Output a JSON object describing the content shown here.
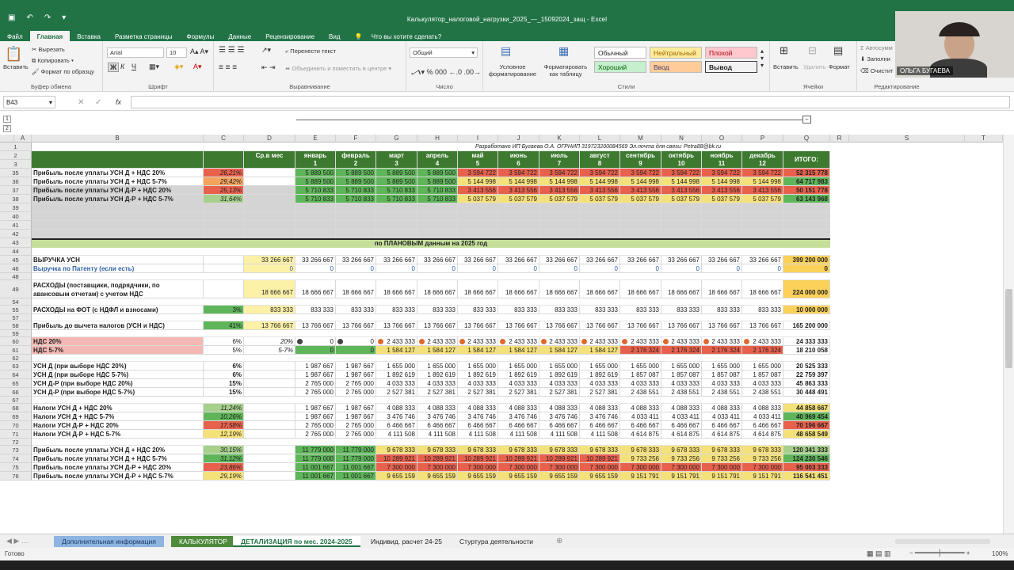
{
  "app": {
    "title": "Калькулятор_налоговой_нагрузки_2025_—_15092024_защ - Excel"
  },
  "ribbon_tabs": [
    "Файл",
    "Главная",
    "Вставка",
    "Разметка страницы",
    "Формулы",
    "Данные",
    "Рецензирование",
    "Вид"
  ],
  "tell_me": "Что вы хотите сделать?",
  "clipboard": {
    "paste": "Вставить",
    "cut": "Вырезать",
    "copy": "Копировать",
    "format_painter": "Формат по образцу",
    "label": "Буфер обмена"
  },
  "font": {
    "name": "Arial",
    "size": "10",
    "label": "Шрифт",
    "bold": "Ж",
    "italic": "К",
    "underline": "Ч"
  },
  "alignment": {
    "wrap": "Перенести текст",
    "merge": "Объединить и поместить в центре",
    "label": "Выравнивание"
  },
  "number": {
    "format": "Общий",
    "label": "Число"
  },
  "styles": {
    "conditional": "Условное форматирование",
    "as_table": "Форматировать как таблицу",
    "normal": "Обычный",
    "neutral": "Нейтральный",
    "bad": "Плохой",
    "good": "Хороший",
    "input": "Ввод",
    "output": "Вывод",
    "label": "Стили"
  },
  "cells": {
    "insert": "Вставить",
    "delete": "Удалить",
    "format": "Формат",
    "label": "Ячейки"
  },
  "editing": {
    "autosum": "Автосумм",
    "fill": "Заполни",
    "clear": "Очистит",
    "label": "Редактирование"
  },
  "webcam_name": "ОЛЬГА БУГАЕВА",
  "formula_bar": {
    "name_box": "B43",
    "fx": "fx",
    "value": ""
  },
  "columns": [
    "A",
    "B",
    "C",
    "D",
    "E",
    "F",
    "G",
    "H",
    "I",
    "J",
    "K",
    "L",
    "M",
    "N",
    "O",
    "P",
    "Q",
    "R",
    "S",
    "T"
  ],
  "header_note": "Разработано ИП Бугаева О.А. ОГРНИП 319723200084569   Эл.почта для связи: Petra88@bk.ru",
  "months": [
    {
      "name": "январь",
      "n": "1"
    },
    {
      "name": "февраль",
      "n": "2"
    },
    {
      "name": "март",
      "n": "3"
    },
    {
      "name": "апрель",
      "n": "4"
    },
    {
      "name": "май",
      "n": "5"
    },
    {
      "name": "июнь",
      "n": "6"
    },
    {
      "name": "июль",
      "n": "7"
    },
    {
      "name": "август",
      "n": "8"
    },
    {
      "name": "сентябрь",
      "n": "9"
    },
    {
      "name": "октябрь",
      "n": "10"
    },
    {
      "name": "ноябрь",
      "n": "11"
    },
    {
      "name": "декабрь",
      "n": "12"
    }
  ],
  "avg_header": "Ср.в мес",
  "total_header": "ИТОГО:",
  "top_rows": [
    {
      "row": "35",
      "label": "Прибыль после уплаты УСН Д + НДС 20%",
      "pct": "26,21%",
      "vals": [
        "5 889 500",
        "5 889 500",
        "5 889 500",
        "5 889 500",
        "3 594 722",
        "3 594 722",
        "3 594 722",
        "3 594 722",
        "3 594 722",
        "3 594 722",
        "3 594 722",
        "3 594 722"
      ],
      "total": "52 315 778"
    },
    {
      "row": "36",
      "label": "Прибыль после уплаты УСН Д + НДС 5-7%",
      "pct": "29,42%",
      "vals": [
        "5 889 500",
        "5 889 500",
        "5 889 500",
        "5 889 500",
        "5 144 998",
        "5 144 998",
        "5 144 998",
        "5 144 998",
        "5 144 998",
        "5 144 998",
        "5 144 998",
        "5 144 998"
      ],
      "total": "64 717 983"
    },
    {
      "row": "37",
      "label": "Прибыль после уплаты УСН Д-Р + НДС 20%",
      "pct": "25,13%",
      "vals": [
        "5 710 833",
        "5 710 833",
        "5 710 833",
        "5 710 833",
        "3 413 556",
        "3 413 556",
        "3 413 556",
        "3 413 556",
        "3 413 556",
        "3 413 556",
        "3 413 556",
        "3 413 556"
      ],
      "total": "50 151 778"
    },
    {
      "row": "38",
      "label": "Прибыль после уплаты  УСН Д-Р + НДС 5-7%",
      "pct": "31,64%",
      "vals": [
        "5 710 833",
        "5 710 833",
        "5 710 833",
        "5 710 833",
        "5 037 579",
        "5 037 579",
        "5 037 579",
        "5 037 579",
        "5 037 579",
        "5 037 579",
        "5 037 579",
        "5 037 579"
      ],
      "total": "63 143 968"
    }
  ],
  "plan_title": "по ПЛАНОВЫМ данным на 2025 год",
  "plan_rows": {
    "r45": {
      "label": "ВЫРУЧКА УСН",
      "avg": "33 266 667",
      "val": "33 266 667",
      "total": "399 200 000"
    },
    "r46": {
      "label": "Выручка по Патенту (если есть)",
      "avg": "0",
      "val": "0",
      "total": "0"
    },
    "r49": {
      "label1": "РАСХОДЫ (поставщики, подрядчики, по",
      "label2": "авансовым отчетам) с учетом НДС",
      "avg": "18 666 667",
      "val": "18 666 667",
      "total": "224 000 000"
    },
    "r55": {
      "label": "РАСХОДЫ на ФОТ (с НДФЛ и взносами)",
      "pct": "3%",
      "avg": "833 333",
      "val": "833 333",
      "total": "10 000 000"
    },
    "r58": {
      "label": "Прибыль до вычета налогов (УСН и НДС)",
      "pct": "41%",
      "avg": "13 766 667",
      "val": "13 766 667",
      "total": "165 200 000"
    },
    "r60": {
      "label": "НДС 20%",
      "pct": "6%",
      "avg": "20%",
      "v1": "0",
      "v2": "0",
      "val": "2 433 333",
      "total": "24 333 333"
    },
    "r61": {
      "label": "НДС 5-7%",
      "pct": "5%",
      "avg": "5-7%",
      "v1": "0",
      "v2": "0",
      "vA": "1 584 127",
      "vB": "2 176 324",
      "total": "18 210 058"
    }
  },
  "tax_rows": [
    {
      "row": "63",
      "label": "УСН Д (при выборе НДС 20%)",
      "pct": "6%",
      "vals": [
        "1 987 667",
        "1 987 667",
        "1 655 000",
        "1 655 000",
        "1 655 000",
        "1 655 000",
        "1 655 000",
        "1 655 000",
        "1 655 000",
        "1 655 000",
        "1 655 000",
        "1 655 000"
      ],
      "total": "20 525 333"
    },
    {
      "row": "64",
      "label": "УСН Д (при выборе НДС 5-7%)",
      "pct": "6%",
      "vals": [
        "1 987 667",
        "1 987 667",
        "1 892 619",
        "1 892 619",
        "1 892 619",
        "1 892 619",
        "1 892 619",
        "1 892 619",
        "1 857 087",
        "1 857 087",
        "1 857 087",
        "1 857 087"
      ],
      "total": "22 759 397"
    },
    {
      "row": "65",
      "label": "УСН Д-Р (при выборе НДС 20%)",
      "pct": "15%",
      "vals": [
        "2 765 000",
        "2 765 000",
        "4 033 333",
        "4 033 333",
        "4 033 333",
        "4 033 333",
        "4 033 333",
        "4 033 333",
        "4 033 333",
        "4 033 333",
        "4 033 333",
        "4 033 333"
      ],
      "total": "45 863 333"
    },
    {
      "row": "66",
      "label": "УСН Д-Р (при выборе НДС 5-7%)",
      "pct": "15%",
      "vals": [
        "2 765 000",
        "2 765 000",
        "2 527 381",
        "2 527 381",
        "2 527 381",
        "2 527 381",
        "2 527 381",
        "2 527 381",
        "2 438 551",
        "2 438 551",
        "2 438 551",
        "2 438 551"
      ],
      "total": "30 448 491"
    }
  ],
  "taxes_rows": [
    {
      "row": "68",
      "label": "Налоги УСН Д + НДС 20%",
      "pct": "11,24%",
      "vals": [
        "1 987 667",
        "1 987 667",
        "4 088 333",
        "4 088 333",
        "4 088 333",
        "4 088 333",
        "4 088 333",
        "4 088 333",
        "4 088 333",
        "4 088 333",
        "4 088 333",
        "4 088 333"
      ],
      "total": "44 858 667"
    },
    {
      "row": "69",
      "label": "Налоги УСН Д + НДС 5-7%",
      "pct": "10,26%",
      "vals": [
        "1 987 667",
        "1 987 667",
        "3 476 746",
        "3 476 746",
        "3 476 746",
        "3 476 746",
        "3 476 746",
        "3 476 746",
        "4 033 411",
        "4 033 411",
        "4 033 411",
        "4 033 411"
      ],
      "total": "40 969 454"
    },
    {
      "row": "70",
      "label": "Налоги УСН Д-Р + НДС 20%",
      "pct": "17,58%",
      "vals": [
        "2 765 000",
        "2 765 000",
        "6 466 667",
        "6 466 667",
        "6 466 667",
        "6 466 667",
        "6 466 667",
        "6 466 667",
        "6 466 667",
        "6 466 667",
        "6 466 667",
        "6 466 667"
      ],
      "total": "70 196 667"
    },
    {
      "row": "71",
      "label": "Налоги УСН Д-Р + НДС 5-7%",
      "pct": "12,19%",
      "vals": [
        "2 765 000",
        "2 765 000",
        "4 111 508",
        "4 111 508",
        "4 111 508",
        "4 111 508",
        "4 111 508",
        "4 111 508",
        "4 614 875",
        "4 614 875",
        "4 614 875",
        "4 614 875"
      ],
      "total": "48 658 549"
    }
  ],
  "profit_rows": [
    {
      "row": "73",
      "label": "Прибыль после уплаты УСН Д + НДС 20%",
      "pct": "30,15%",
      "vals": [
        "11 779 000",
        "11 779 000",
        "9 678 333",
        "9 678 333",
        "9 678 333",
        "9 678 333",
        "9 678 333",
        "9 678 333",
        "9 678 333",
        "9 678 333",
        "9 678 333",
        "9 678 333"
      ],
      "total": "120 341 333"
    },
    {
      "row": "74",
      "label": "Прибыль после уплаты УСН Д + НДС 5-7%",
      "pct": "31,12%",
      "vals": [
        "11 779 000",
        "11 779 000",
        "10 289 921",
        "10 289 921",
        "10 289 921",
        "10 289 921",
        "10 289 921",
        "10 289 921",
        "9 733 256",
        "9 733 256",
        "9 733 256",
        "9 733 256"
      ],
      "total": "124 230 546"
    },
    {
      "row": "75",
      "label": "Прибыль после уплаты  УСН Д-Р + НДС 20%",
      "pct": "23,86%",
      "vals": [
        "11 001 667",
        "11 001 667",
        "7 300 000",
        "7 300 000",
        "7 300 000",
        "7 300 000",
        "7 300 000",
        "7 300 000",
        "7 300 000",
        "7 300 000",
        "7 300 000",
        "7 300 000"
      ],
      "total": "95 003 333"
    },
    {
      "row": "76",
      "label": "Прибыль после уплаты  УСН Д-Р + НДС 5-7%",
      "pct": "29,19%",
      "vals": [
        "11 001 667",
        "11 001 667",
        "9 655 159",
        "9 655 159",
        "9 655 159",
        "9 655 159",
        "9 655 159",
        "9 655 159",
        "9 151 791",
        "9 151 791",
        "9 151 791",
        "9 151 791"
      ],
      "total": "116 541 451"
    }
  ],
  "sheet_tabs": [
    "Дополнительная информация",
    "КАЛЬКУЛЯТОР",
    "ДЕТАЛИЗАЦИЯ по мес. 2024-2025",
    "Индивид. расчет 24-25",
    "Стуртура деятельности"
  ],
  "status": {
    "ready": "Готово",
    "zoom": "100%"
  },
  "colors": {
    "excel_green": "#217346",
    "header_green": "#3d7a30",
    "band_green": "#c5df9b"
  }
}
